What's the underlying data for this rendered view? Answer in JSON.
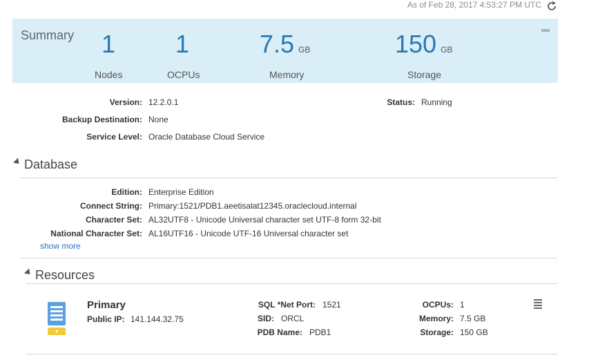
{
  "header": {
    "as_of": "As of Feb 28, 2017 4:53:27 PM UTC",
    "refresh_icon": "refresh-icon"
  },
  "summary": {
    "title": "Summary",
    "minimize_icon": "minimize-icon",
    "metrics": [
      {
        "value": "1",
        "unit": "",
        "label": "Nodes"
      },
      {
        "value": "1",
        "unit": "",
        "label": "OCPUs"
      },
      {
        "value": "7.5",
        "unit": "GB",
        "label": "Memory"
      },
      {
        "value": "150",
        "unit": "GB",
        "label": "Storage"
      }
    ]
  },
  "details": {
    "version_label": "Version:",
    "version": "12.2.0.1",
    "status_label": "Status:",
    "status": "Running",
    "backup_label": "Backup Destination:",
    "backup": "None",
    "service_level_label": "Service Level:",
    "service_level": "Oracle Database Cloud Service"
  },
  "database": {
    "title": "Database",
    "edition_label": "Edition:",
    "edition": "Enterprise Edition",
    "connect_label": "Connect String:",
    "connect": "Primary:1521/PDB1.aeetisalat12345.oraclecloud.internal",
    "charset_label": "Character Set:",
    "charset": "AL32UTF8 - Unicode Universal character set UTF-8 form 32-bit",
    "ncharset_label": "National Character Set:",
    "ncharset": "AL16UTF16 - Unicode UTF-16 Universal character set",
    "show_more": "show more"
  },
  "resources": {
    "title": "Resources",
    "icon": "database-server-icon",
    "menu_icon": "hamburger-menu-icon",
    "node": {
      "name": "Primary",
      "public_ip_label": "Public IP:",
      "public_ip": "141.144.32.75",
      "sqlnet_label": "SQL *Net Port:",
      "sqlnet": "1521",
      "sid_label": "SID:",
      "sid": "ORCL",
      "pdb_label": "PDB Name:",
      "pdb": "PDB1",
      "ocpus_label": "OCPUs:",
      "ocpus": "1",
      "memory_label": "Memory:",
      "memory": "7.5 GB",
      "storage_label": "Storage:",
      "storage": "150 GB"
    }
  },
  "colors": {
    "summary_bg": "#d9eef6",
    "accent": "#2a77b6",
    "icon_blue": "#5aa1e0",
    "icon_yellow": "#f3c93a"
  }
}
